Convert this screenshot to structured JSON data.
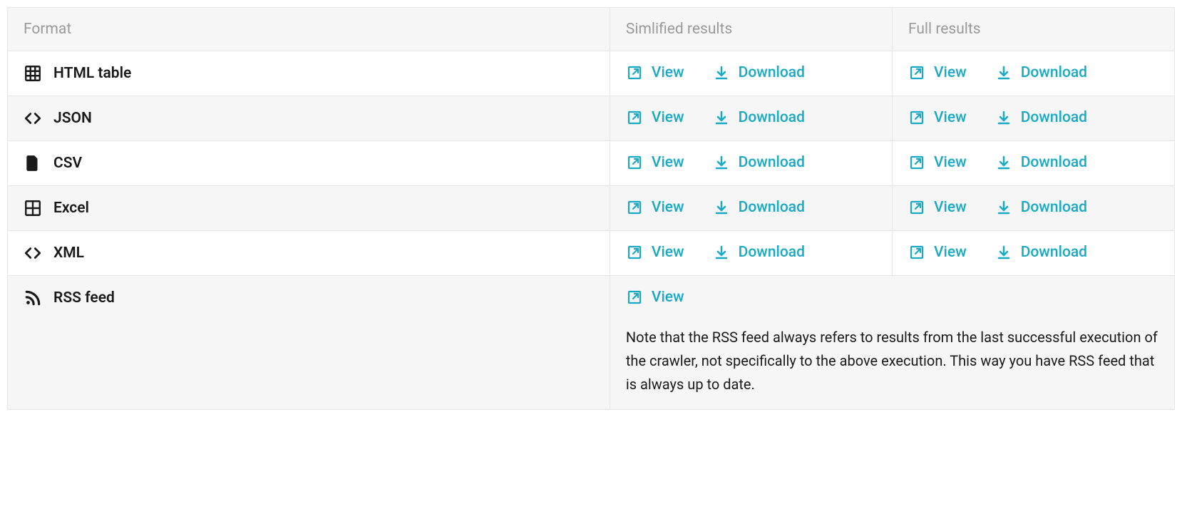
{
  "headers": {
    "format": "Format",
    "simplified": "Simlified results",
    "full": "Full results"
  },
  "labels": {
    "view": "View",
    "download": "Download"
  },
  "formats": [
    {
      "name": "HTML table",
      "icon": "grid"
    },
    {
      "name": "JSON",
      "icon": "code"
    },
    {
      "name": "CSV",
      "icon": "file"
    },
    {
      "name": "Excel",
      "icon": "excel"
    },
    {
      "name": "XML",
      "icon": "code"
    }
  ],
  "rss": {
    "name": "RSS feed",
    "icon": "rss",
    "note": "Note that the RSS feed always refers to results from the last successful execution of the crawler, not specifically to the above execution. This way you have RSS feed that is always up to date."
  }
}
